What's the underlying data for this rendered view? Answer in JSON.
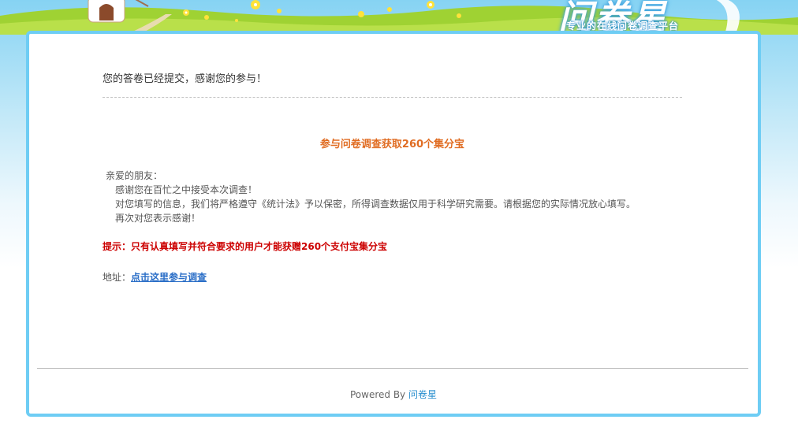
{
  "header": {
    "brand": "问卷星",
    "tagline": "专业的在线问卷调查平台",
    "colors": {
      "sky": "#86d3f3",
      "grass": "#9fd233",
      "panel_border": "#6ecdf4"
    }
  },
  "main": {
    "submitted_message": "您的答卷已经提交，感谢您的参与！",
    "promo_title": "参与问卷调查获取260个集分宝",
    "letter": {
      "greeting": "亲爱的朋友：",
      "line1": "感谢您在百忙之中接受本次调查！",
      "line2": "对您填写的信息，我们将严格遵守《统计法》予以保密，所得调查数据仅用于科学研究需要。请根据您的实际情况放心填写。",
      "line3": "再次对您表示感谢！"
    },
    "tip": "提示：只有认真填写并符合要求的用户才能获赠260个支付宝集分宝",
    "address_label": "地址：",
    "address_link": "点击这里参与调查",
    "colors": {
      "promo": "#e06c22",
      "tip": "#cc0000",
      "link": "#2a6ec7"
    }
  },
  "footer": {
    "powered_by": "Powered By",
    "brand_link": "问卷星"
  }
}
